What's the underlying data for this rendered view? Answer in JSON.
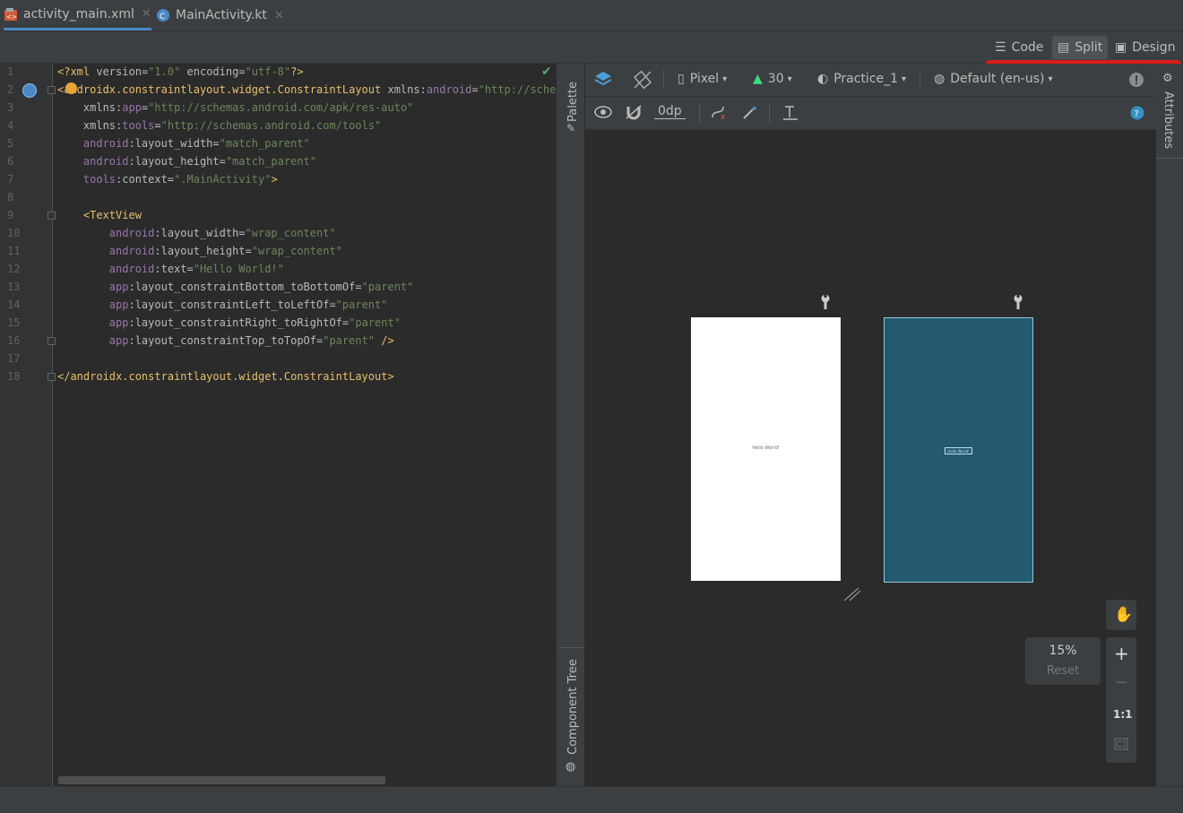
{
  "tabs": [
    {
      "label": "activity_main.xml",
      "active": true
    },
    {
      "label": "MainActivity.kt",
      "active": false
    }
  ],
  "view_modes": {
    "code": "Code",
    "split": "Split",
    "design": "Design",
    "selected": "Split"
  },
  "editor": {
    "line_numbers": [
      "1",
      "2",
      "3",
      "4",
      "5",
      "6",
      "7",
      "8",
      "9",
      "10",
      "11",
      "12",
      "13",
      "14",
      "15",
      "16",
      "17",
      "18"
    ]
  },
  "design_toolbar": {
    "device": "Pixel",
    "api": "30",
    "theme": "Practice_1",
    "locale": "Default (en-us)",
    "margin": "0dp"
  },
  "side_panels": {
    "palette": "Palette",
    "component_tree": "Component Tree",
    "attributes": "Attributes"
  },
  "preview": {
    "hello_text": "Hello World!"
  },
  "zoom": {
    "level": "15%",
    "reset": "Reset",
    "one_to_one": "1:1"
  },
  "colors": {
    "accent": "#4a88c7",
    "blueprint": "#235a6e",
    "annotation_red": "#e01a1a"
  }
}
